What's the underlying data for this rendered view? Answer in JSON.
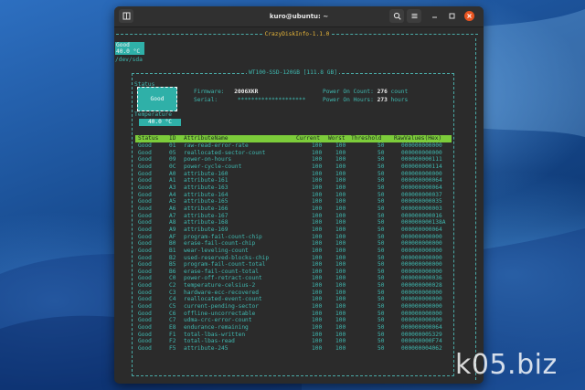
{
  "window": {
    "title": "kuro@ubuntu: ~"
  },
  "header": {
    "new_tab_icon": "new-tab-icon",
    "search_icon": "search-icon",
    "menu_icon": "hamburger-menu-icon",
    "minimize_icon": "minimize-icon",
    "maximize_icon": "maximize-icon",
    "close_icon": "close-icon"
  },
  "app": {
    "title": "CrazyDiskInfo-1.1.0"
  },
  "sidebar": {
    "status": "Good",
    "temp": "40.0 °C",
    "device": "/dev/sda"
  },
  "disk": {
    "title": "WT100-SSD-120GB [111.8 GB]",
    "status_label": "Status",
    "status_value": "Good",
    "temperature_label": "Temperature",
    "temperature_value": "40.0 °C",
    "firmware_label": "Firmware:",
    "firmware_value": "2006XKR",
    "serial_label": "Serial:",
    "serial_value": "********************",
    "power_on_count_label": "Power On Count:",
    "power_on_count_value": "276",
    "power_on_count_unit": "count",
    "power_on_hours_label": "Power On Hours:",
    "power_on_hours_value": "273",
    "power_on_hours_unit": "hours"
  },
  "table": {
    "columns": [
      "Status",
      "ID",
      "AttributeName",
      "Current",
      "Worst",
      "Threshold",
      "RawValues(Hex)"
    ],
    "rows": [
      [
        "Good",
        "01",
        "raw-read-error-rate",
        "100",
        "100",
        "50",
        "000000000000"
      ],
      [
        "Good",
        "05",
        "reallocated-sector-count",
        "100",
        "100",
        "50",
        "000000000000"
      ],
      [
        "Good",
        "09",
        "power-on-hours",
        "100",
        "100",
        "50",
        "000000000111"
      ],
      [
        "Good",
        "0C",
        "power-cycle-count",
        "100",
        "100",
        "50",
        "000000000114"
      ],
      [
        "Good",
        "A0",
        "attribute-160",
        "100",
        "100",
        "50",
        "000000000000"
      ],
      [
        "Good",
        "A1",
        "attribute-161",
        "100",
        "100",
        "50",
        "000000000064"
      ],
      [
        "Good",
        "A3",
        "attribute-163",
        "100",
        "100",
        "50",
        "000000000064"
      ],
      [
        "Good",
        "A4",
        "attribute-164",
        "100",
        "100",
        "50",
        "000000000037"
      ],
      [
        "Good",
        "A5",
        "attribute-165",
        "100",
        "100",
        "50",
        "000000000035"
      ],
      [
        "Good",
        "A6",
        "attribute-166",
        "100",
        "100",
        "50",
        "000000000003"
      ],
      [
        "Good",
        "A7",
        "attribute-167",
        "100",
        "100",
        "50",
        "000000000016"
      ],
      [
        "Good",
        "A8",
        "attribute-168",
        "100",
        "100",
        "50",
        "000000000138A"
      ],
      [
        "Good",
        "A9",
        "attribute-169",
        "100",
        "100",
        "50",
        "000000000064"
      ],
      [
        "Good",
        "AF",
        "program-fail-count-chip",
        "100",
        "100",
        "50",
        "000000000000"
      ],
      [
        "Good",
        "B0",
        "erase-fail-count-chip",
        "100",
        "100",
        "50",
        "000000000000"
      ],
      [
        "Good",
        "B1",
        "wear-leveling-count",
        "100",
        "100",
        "50",
        "000000000000"
      ],
      [
        "Good",
        "B2",
        "used-reserved-blocks-chip",
        "100",
        "100",
        "50",
        "000000000000"
      ],
      [
        "Good",
        "B5",
        "program-fail-count-total",
        "100",
        "100",
        "50",
        "000000000000"
      ],
      [
        "Good",
        "B6",
        "erase-fail-count-total",
        "100",
        "100",
        "50",
        "000000000000"
      ],
      [
        "Good",
        "C0",
        "power-off-retract-count",
        "100",
        "100",
        "50",
        "000000000036"
      ],
      [
        "Good",
        "C2",
        "temperature-celsius-2",
        "100",
        "100",
        "50",
        "000000000028"
      ],
      [
        "Good",
        "C3",
        "hardware-ecc-recovered",
        "100",
        "100",
        "50",
        "000000000000"
      ],
      [
        "Good",
        "C4",
        "reallocated-event-count",
        "100",
        "100",
        "50",
        "000000000000"
      ],
      [
        "Good",
        "C5",
        "current-pending-sector",
        "100",
        "100",
        "50",
        "000000000000"
      ],
      [
        "Good",
        "C6",
        "offline-uncorrectable",
        "100",
        "100",
        "50",
        "000000000000"
      ],
      [
        "Good",
        "C7",
        "udma-crc-error-count",
        "100",
        "100",
        "50",
        "000000000000"
      ],
      [
        "Good",
        "E8",
        "endurance-remaining",
        "100",
        "100",
        "50",
        "000000000064"
      ],
      [
        "Good",
        "F1",
        "total-lbas-written",
        "100",
        "100",
        "50",
        "000000005329"
      ],
      [
        "Good",
        "F2",
        "total-lbas-read",
        "100",
        "100",
        "50",
        "000000000F74"
      ],
      [
        "Good",
        "F5",
        "attribute-245",
        "100",
        "100",
        "50",
        "000000004062"
      ]
    ]
  },
  "watermark": {
    "text": "k05.biz"
  },
  "colors": {
    "accent_teal": "#2fb0a8",
    "header_green": "#7ccc3a",
    "title_amber": "#e8b63a",
    "close_orange": "#e95420"
  }
}
